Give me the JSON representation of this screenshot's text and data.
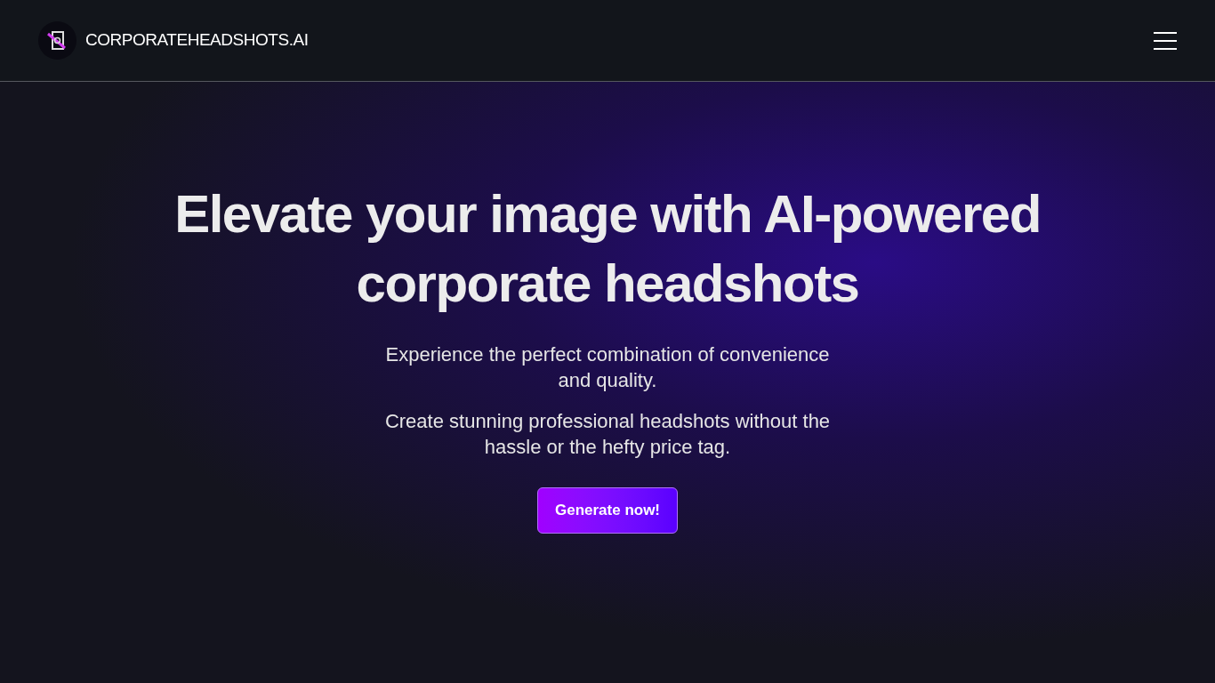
{
  "header": {
    "brand": "CORPORATEHEADSHOTS.AI"
  },
  "hero": {
    "title_lines": [
      "Elevate your image with AI-powered",
      "corporate headshots"
    ],
    "paragraphs": [
      "Experience the perfect combination of convenience and quality.",
      "Create stunning professional headshots without the hassle or the hefty price tag."
    ],
    "button": "Generate now!"
  }
}
